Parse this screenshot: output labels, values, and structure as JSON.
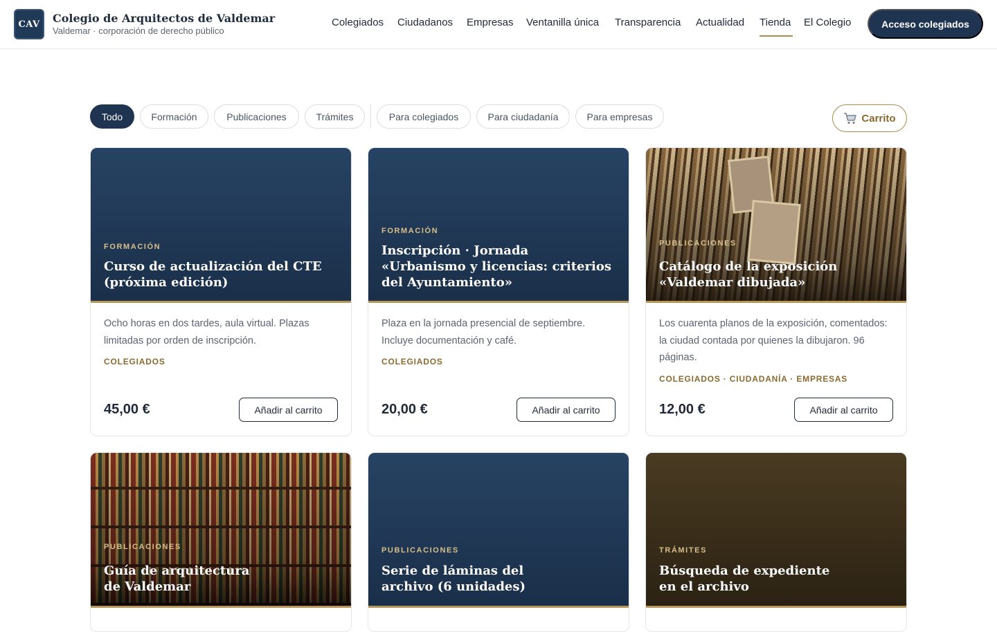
{
  "brand": {
    "logo_text": "CAV",
    "title": "Colegio de Arquitectos de Valdemar",
    "subtitle": "Valdemar · corporación de derecho público"
  },
  "nav": {
    "items": [
      "Colegiados",
      "Ciudadanos",
      "Empresas",
      "Ventanilla única",
      "Transparencia",
      "Actualidad",
      "Tienda",
      "El Colegio"
    ],
    "active": "Tienda",
    "login_label": "Acceso colegiados"
  },
  "filters": {
    "chips": [
      "Todo",
      "Formación",
      "Publicaciones",
      "Trámites",
      "Para colegiados",
      "Para ciudadanía",
      "Para empresas"
    ],
    "active": "Todo",
    "cart_label": "Carrito",
    "cart_icon": "cart-icon"
  },
  "products": [
    {
      "category": "FORMACIÓN",
      "title": "Curso de actualización del CTE (próxima edición)",
      "description": "Ocho horas en dos tardes, aula virtual. Plazas limitadas por orden de inscripción.",
      "audience": "COLEGIADOS",
      "price": "45,00 €",
      "button": "Añadir al carrito"
    },
    {
      "category": "FORMACIÓN",
      "title": "Inscripción · Jornada «Urbanismo y licencias: criterios del Ayuntamiento»",
      "description": "Plaza en la jornada presencial de septiembre. Incluye documentación y café.",
      "audience": "COLEGIADOS",
      "price": "20,00 €",
      "button": "Añadir al carrito"
    },
    {
      "category": "PUBLICACIONES",
      "title": "Catálogo de la exposición «Valdemar dibujada»",
      "description": "Los cuarenta planos de la exposición, comentados: la ciudad contada por quienes la dibujaron. 96 páginas.",
      "audience": "COLEGIADOS · CIUDADANÍA · EMPRESAS",
      "price": "12,00 €",
      "button": "Añadir al carrito"
    },
    {
      "category": "PUBLICACIONES",
      "title": "Guía de arquitectura de Valdemar"
    },
    {
      "category": "PUBLICACIONES",
      "title": "Serie de láminas del archivo (6 unidades)"
    },
    {
      "category": "TRÁMITES",
      "title": "Búsqueda de expediente en el archivo"
    }
  ],
  "colors": {
    "navy": "#1f3450",
    "gold": "#b08a4a",
    "gold_text": "#8a6a2f"
  }
}
